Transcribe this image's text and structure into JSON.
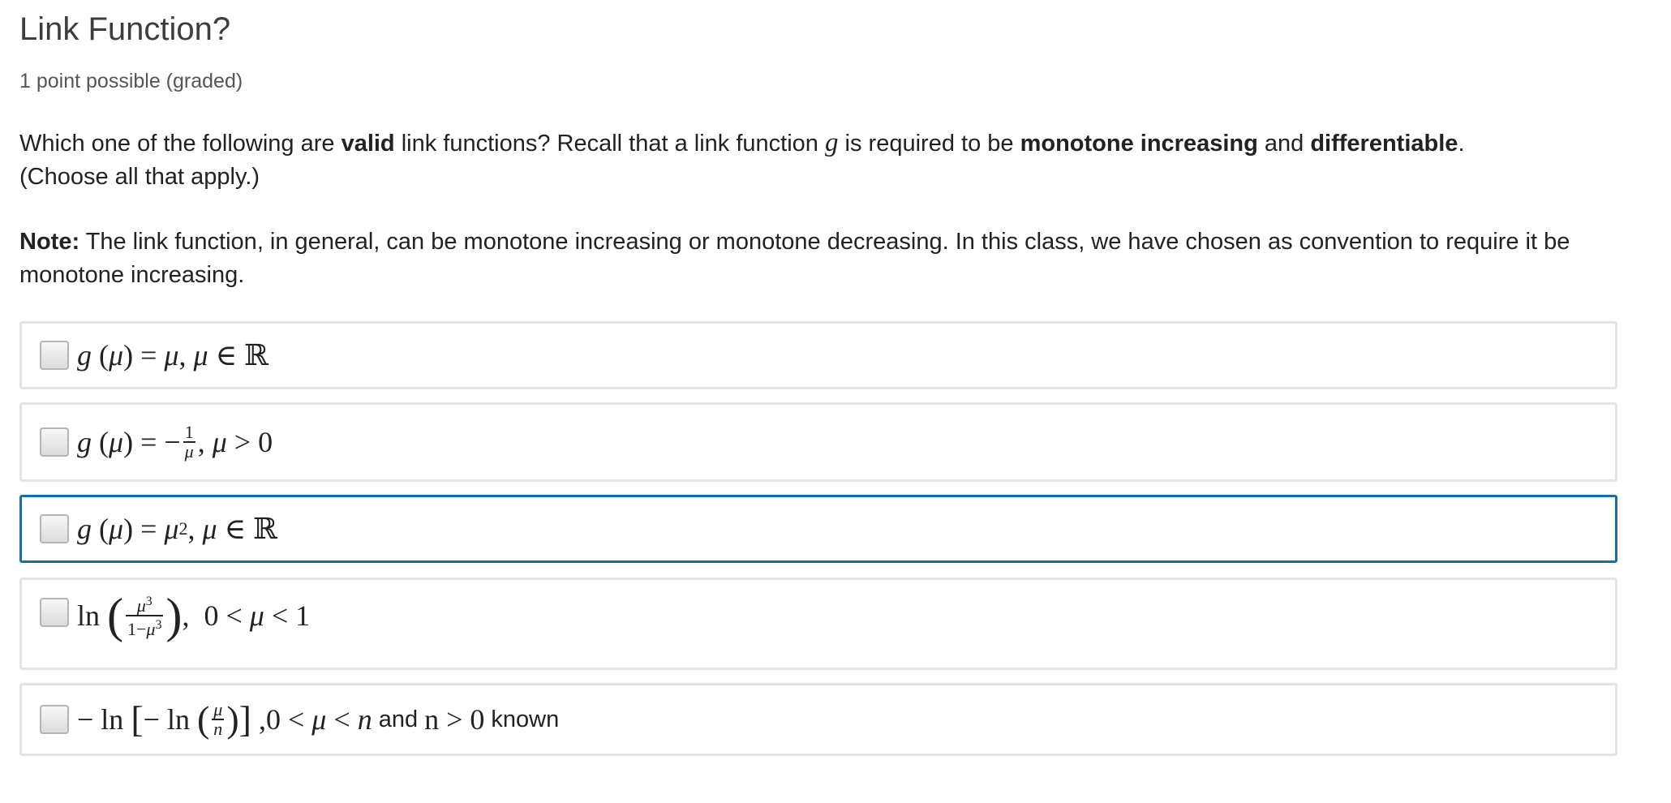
{
  "problem": {
    "title": "Link Function?",
    "points": "1 point possible (graded)",
    "prompt": {
      "p1": "Which one of the following are ",
      "b1": "valid",
      "p2": " link functions? Recall that a link function ",
      "var": "g",
      "p3": " is required to be ",
      "b2": "monotone increasing",
      "p4": " and ",
      "b3": "differentiable",
      "p5": ".",
      "p6": "(Choose all that apply.)"
    },
    "note": {
      "label": "Note:",
      "text": " The link function, in general, can be monotone increasing or monotone decreasing. In this class, we have chosen as convention to require it be monotone increasing."
    }
  },
  "choices": [
    {
      "id": "choice-1",
      "latex": "g(\\mu) = \\mu, \\mu \\in \\mathbb{R}",
      "checked": false
    },
    {
      "id": "choice-2",
      "latex": "g(\\mu) = -\\frac{1}{\\mu}, \\mu > 0",
      "checked": false
    },
    {
      "id": "choice-3",
      "latex": "g(\\mu) = \\mu^2, \\mu \\in \\mathbb{R}",
      "checked": false,
      "focused": true
    },
    {
      "id": "choice-4",
      "latex": "\\ln\\left(\\frac{\\mu^3}{1-\\mu^3}\\right), 0 < \\mu < 1",
      "checked": false
    },
    {
      "id": "choice-5",
      "latex": "-\\ln\\left[-\\ln\\left(\\frac{\\mu}{n}\\right)\\right], 0 < \\mu < n",
      "suffix_and": "and",
      "suffix_cond": "n > 0",
      "suffix_known": "known",
      "checked": false
    }
  ],
  "colors": {
    "focus_border": "#1a6fa8",
    "choice_border": "#e4e4e4",
    "text": "#222222"
  }
}
